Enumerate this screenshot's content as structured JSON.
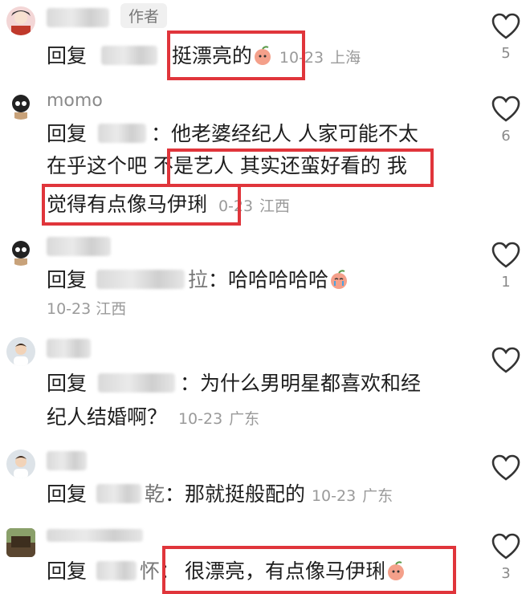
{
  "comments": [
    {
      "author_tag": "作者",
      "reply_label": "回复",
      "text": "挺漂亮的",
      "time": "10-23",
      "location": "上海",
      "likes": "5"
    },
    {
      "username": "momo",
      "reply_label": "回复",
      "colon": "：",
      "text_line1": "他老婆经纪人 人家可能不太",
      "text_line2a": "在乎这个吧 ",
      "text_line2b": "不是艺人 其实还蛮好看的",
      "text_line2c": " 我",
      "text_line3": "觉得有点像马伊琍",
      "time": "0-23",
      "location": "江西",
      "likes": "6"
    },
    {
      "reply_label": "回复",
      "name_fragment": "拉",
      "colon": "：",
      "text": "哈哈哈哈哈",
      "time": "10-23",
      "location": "江西",
      "likes": "1"
    },
    {
      "reply_label": "回复",
      "colon": "：",
      "text_line1": "为什么男明星都喜欢和经",
      "text_line2": "纪人结婚啊？",
      "time": "10-23",
      "location": "广东"
    },
    {
      "reply_label": "回复",
      "name_fragment": "乾",
      "colon": "：",
      "text": "那就挺般配的",
      "time": "10-23",
      "location": "广东"
    },
    {
      "reply_label": "回复",
      "name_fragment": "怀",
      "colon": "：",
      "text": "很漂亮，有点像马伊琍",
      "likes": "3"
    }
  ],
  "icons": {
    "like": "heart-outline-icon",
    "emoji_peach": "peach-emoji-icon",
    "emoji_cry": "crying-peach-emoji-icon"
  },
  "colors": {
    "highlight": "#e0353b",
    "meta": "#9a9a9a"
  }
}
